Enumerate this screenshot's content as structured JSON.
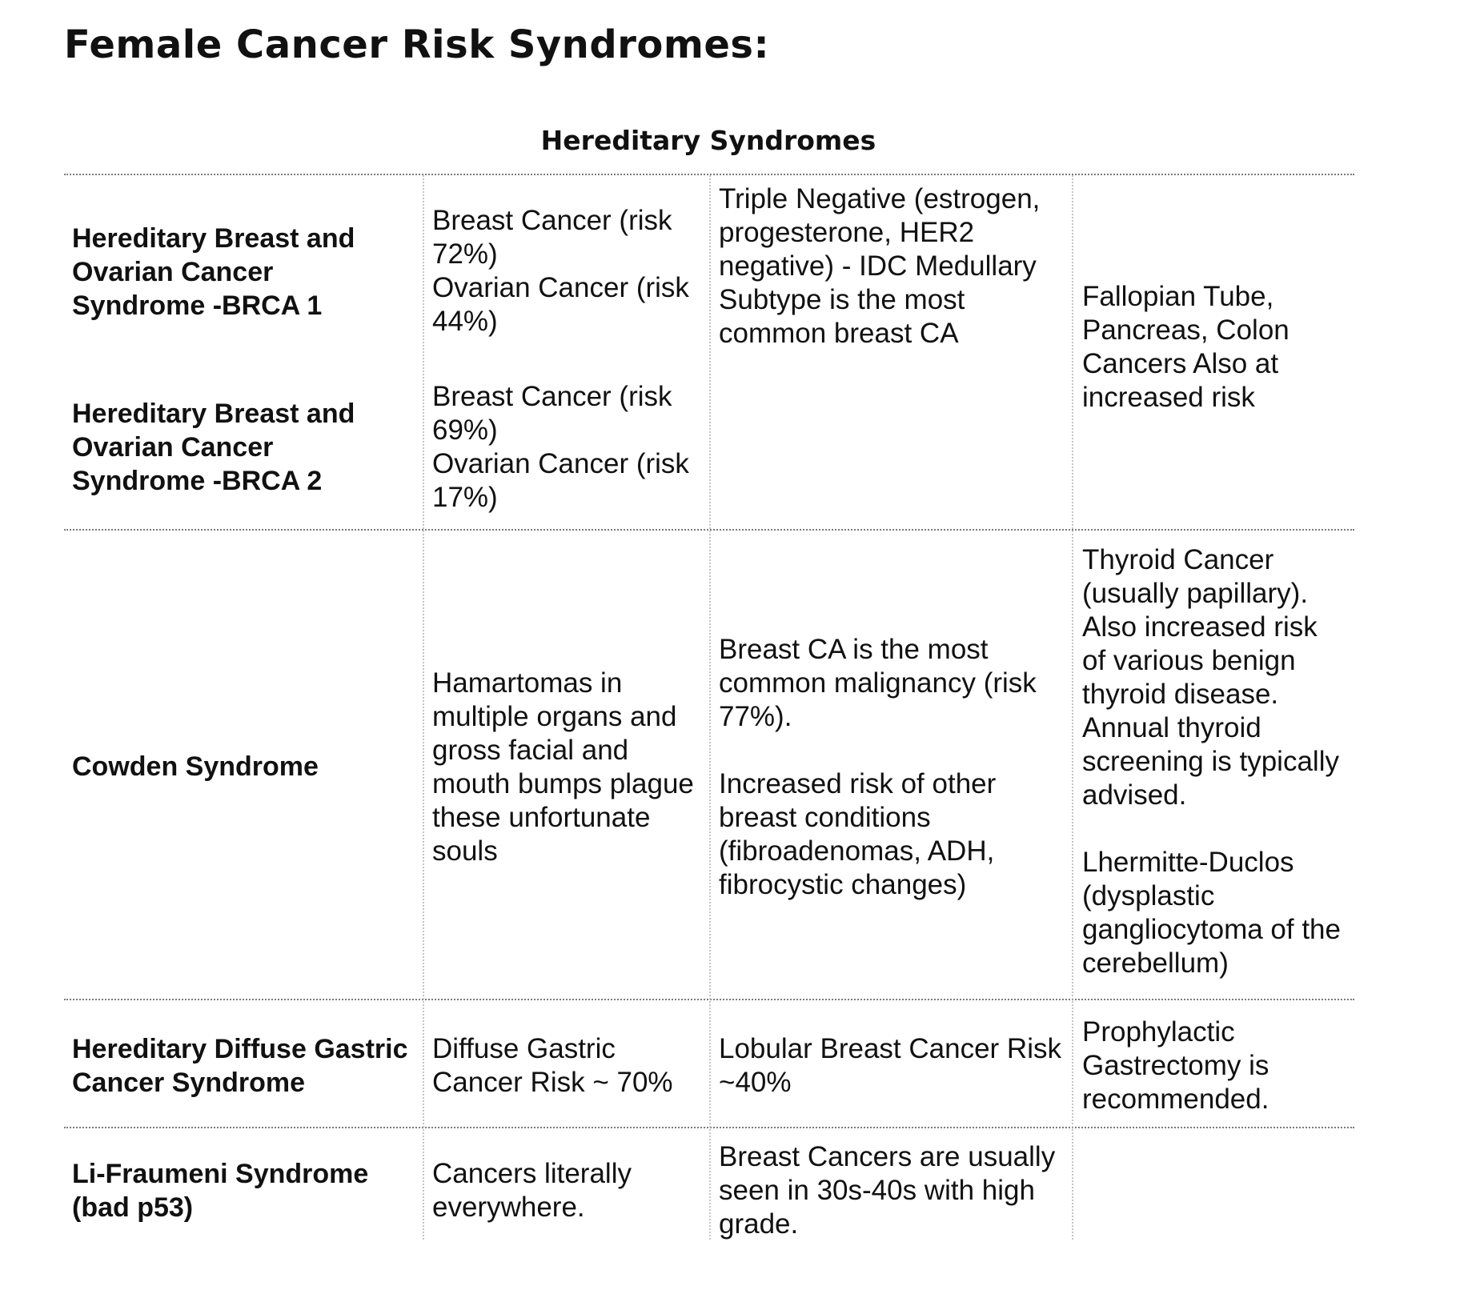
{
  "page": {
    "title": "Female Cancer Risk Syndromes:",
    "section_title": "Hereditary Syndromes"
  },
  "table": {
    "brca1": {
      "name": "Hereditary Breast and Ovarian Cancer Syndrome -BRCA 1",
      "risks": [
        "Breast Cancer (risk 72%)",
        "Ovarian Cancer (risk 44%)"
      ]
    },
    "brca2": {
      "name": "Hereditary Breast and Ovarian Cancer Syndrome -BRCA 2",
      "risks": [
        "Breast Cancer (risk 69%)",
        "Ovarian Cancer (risk 17%)"
      ]
    },
    "brca_shared": {
      "breast_notes": "Triple Negative (estrogen, progesterone, HER2 negative) - IDC Medullary Subtype is the most common breast CA",
      "other": "Fallopian Tube, Pancreas, Colon Cancers Also at increased risk"
    },
    "cowden": {
      "name": "Cowden Syndrome",
      "features": "Hamartomas in multiple organs and gross facial and mouth bumps plague these unfortunate souls",
      "breast_notes": [
        "Breast CA is the most common malignancy (risk 77%).",
        "Increased risk of other breast conditions (fibroadenomas, ADH, fibrocystic changes)"
      ],
      "other": [
        "Thyroid Cancer (usually papillary). Also increased risk of various benign thyroid disease. Annual thyroid screening is typically advised.",
        "Lhermitte-Duclos (dysplastic gangliocytoma of the cerebellum)"
      ]
    },
    "hdgc": {
      "name": "Hereditary Diffuse Gastric Cancer Syndrome",
      "features": "Diffuse Gastric Cancer Risk ~ 70%",
      "breast_notes": "Lobular Breast Cancer Risk ~40%",
      "other": "Prophylactic Gastrectomy is recommended."
    },
    "li_fraumeni": {
      "name": "Li-Fraumeni Syndrome (bad p53)",
      "features": "Cancers literally everywhere.",
      "breast_notes": "Breast Cancers are usually seen in 30s-40s with high grade.",
      "other": ""
    }
  }
}
